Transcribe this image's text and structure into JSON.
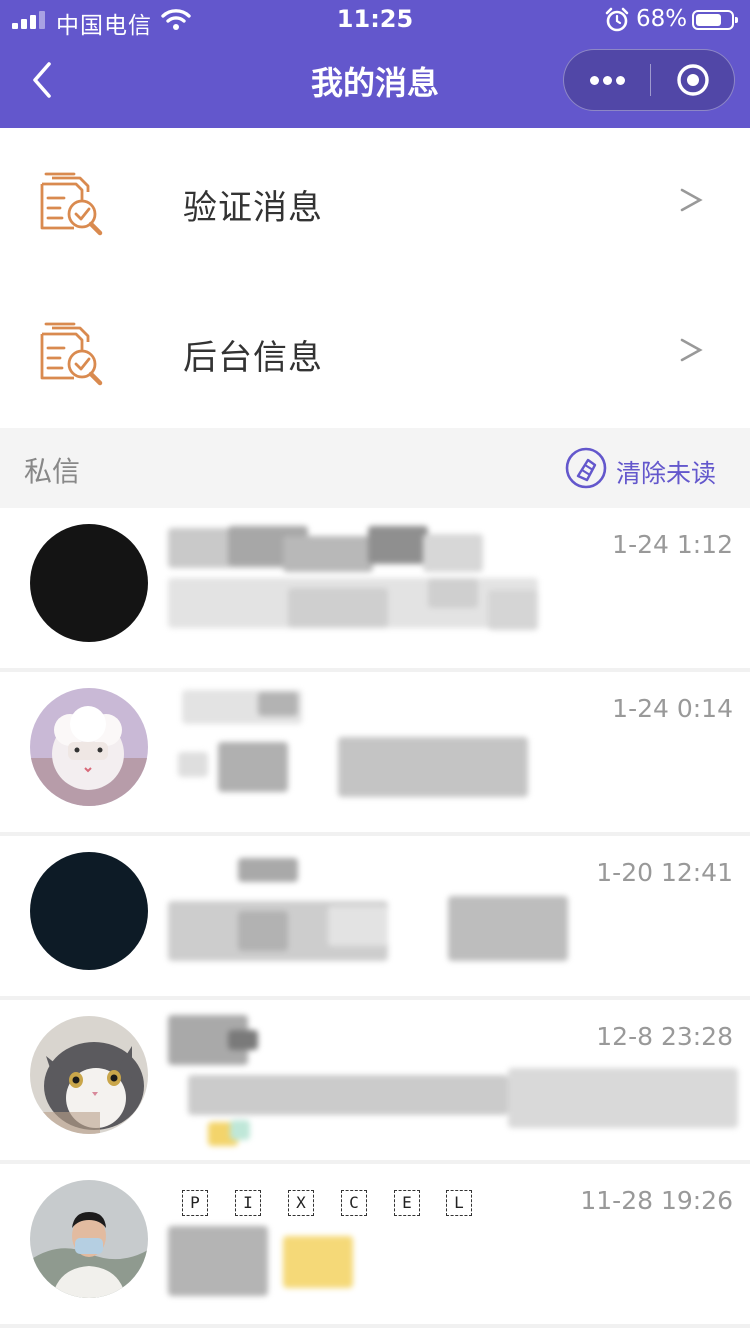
{
  "status_bar": {
    "carrier": "中国电信",
    "time": "11:25",
    "battery": "68%"
  },
  "nav": {
    "title": "我的消息"
  },
  "menu": [
    {
      "label": "验证消息",
      "icon": "document-check-icon",
      "arrow": ">"
    },
    {
      "label": "后台信息",
      "icon": "document-check-icon",
      "arrow": ">"
    }
  ],
  "section": {
    "title": "私信",
    "clear_label": "清除未读"
  },
  "messages": [
    {
      "time": "1-24 1:12",
      "avatar": "black-avatar"
    },
    {
      "time": "1-24 0:14",
      "avatar": "plush-sheep-avatar"
    },
    {
      "time": "1-20 12:41",
      "avatar": "dark-navy-avatar"
    },
    {
      "time": "12-8 23:28",
      "avatar": "cat-avatar"
    },
    {
      "time": "11-28 19:26",
      "avatar": "person-avatar",
      "name_letters": [
        "P",
        "I",
        "X",
        "C",
        "E",
        "L"
      ]
    }
  ],
  "colors": {
    "primary": "#6357cc",
    "menu_icon": "#d98a4f",
    "section_bg": "#f4f4f4"
  }
}
